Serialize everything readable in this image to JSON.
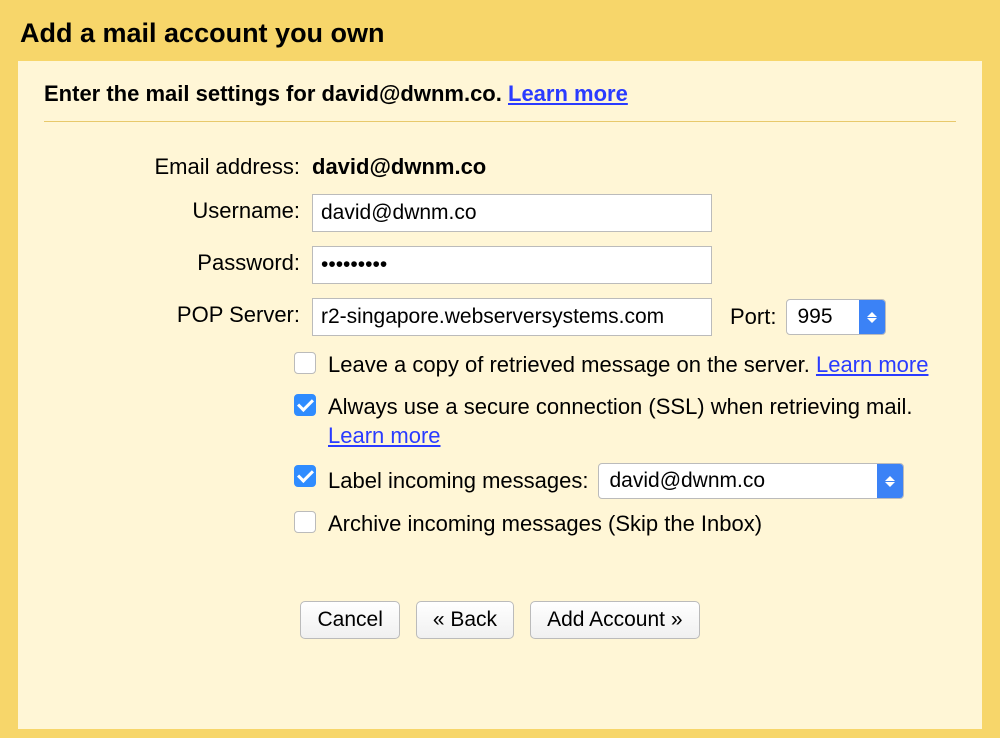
{
  "title": "Add a mail account you own",
  "subtitle_prefix": "Enter the mail settings for ",
  "subtitle_email": "david@dwnm.co.",
  "learn_more": "Learn more",
  "fields": {
    "email_label": "Email address:",
    "email_value": "david@dwnm.co",
    "username_label": "Username:",
    "username_value": "david@dwnm.co",
    "password_label": "Password:",
    "password_value": "•••••••••",
    "pop_label": "POP Server:",
    "pop_value": "r2-singapore.webserversystems.com",
    "port_label": "Port:",
    "port_value": "995"
  },
  "options": {
    "leave_copy": "Leave a copy of retrieved message on the server.",
    "ssl": "Always use a secure connection (SSL) when retrieving mail.",
    "label_incoming": "Label incoming messages:",
    "label_value": "david@dwnm.co",
    "archive": "Archive incoming messages (Skip the Inbox)"
  },
  "buttons": {
    "cancel": "Cancel",
    "back": "« Back",
    "add": "Add Account »"
  }
}
